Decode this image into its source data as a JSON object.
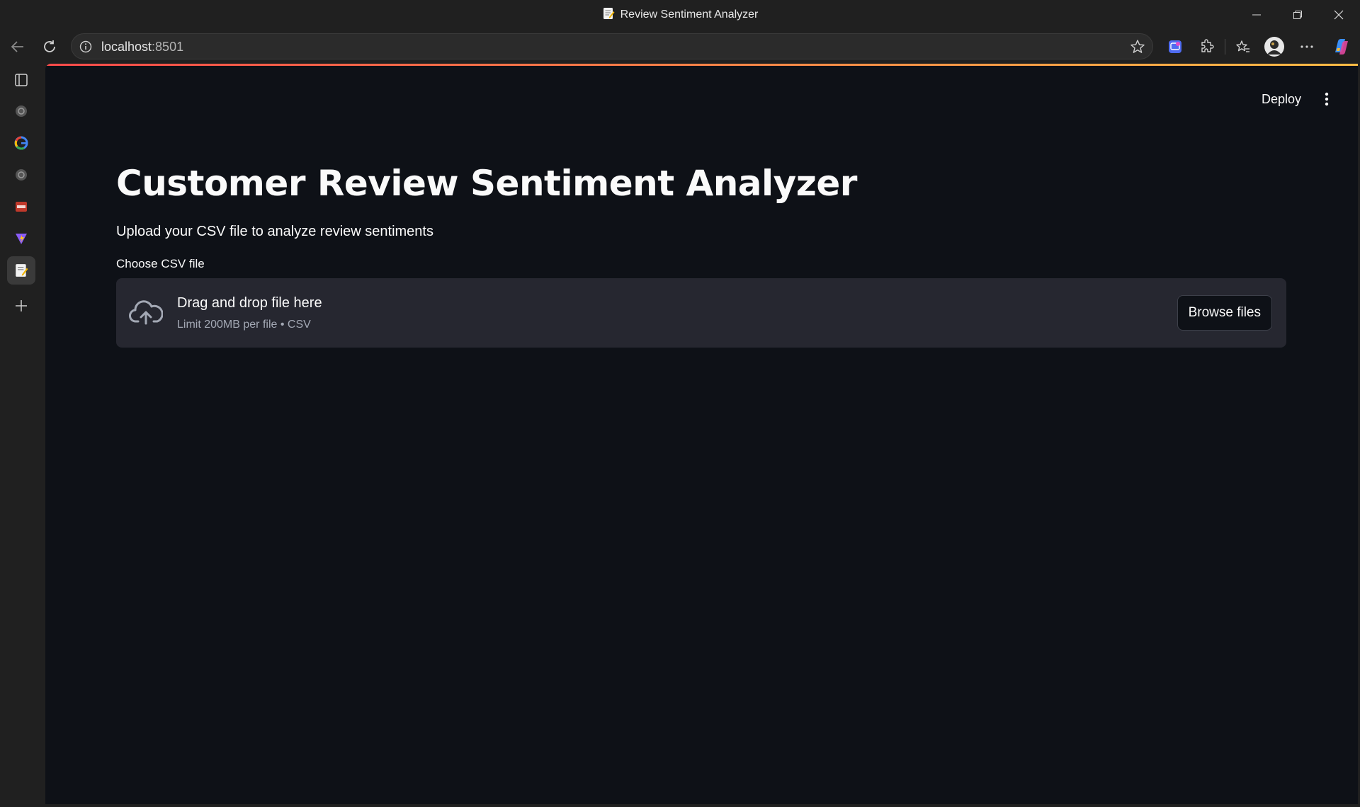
{
  "window": {
    "title": "Review Sentiment Analyzer"
  },
  "browser": {
    "url_host": "localhost",
    "url_port": ":8501"
  },
  "page": {
    "deploy_label": "Deploy",
    "title": "Customer Review Sentiment Analyzer",
    "subtitle": "Upload your CSV file to analyze review sentiments",
    "uploader": {
      "label": "Choose CSV file",
      "drop_text": "Drag and drop file here",
      "limit_text": "Limit 200MB per file • CSV",
      "browse_label": "Browse files"
    }
  },
  "colors": {
    "background": "#0e1117",
    "dropzone": "#262730",
    "text": "#fafafa",
    "accent_start": "#ff4b4b",
    "accent_end": "#ffbd45"
  }
}
